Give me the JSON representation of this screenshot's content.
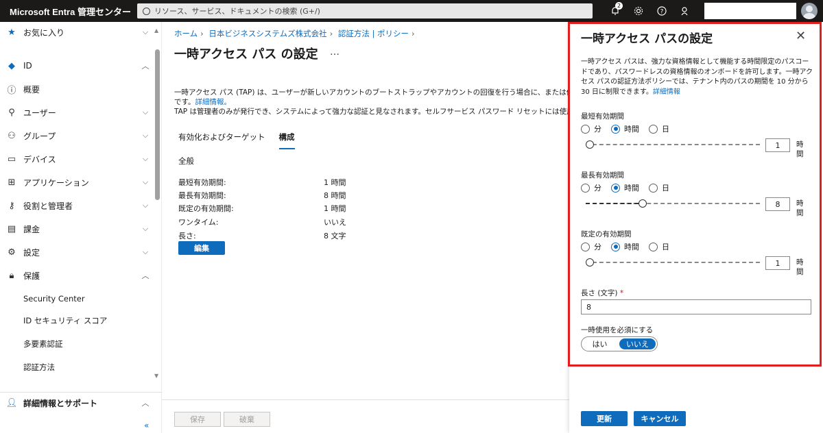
{
  "topbar": {
    "brand": "Microsoft Entra 管理センター",
    "search_placeholder": "リソース、サービス、ドキュメントの検索 (G+/)",
    "notification_count": "2"
  },
  "sidebar": {
    "favorites": "お気に入り",
    "id": "ID",
    "overview": "概要",
    "users": "ユーザー",
    "groups": "グループ",
    "devices": "デバイス",
    "applications": "アプリケーション",
    "roles": "役割と管理者",
    "billing": "課金",
    "settings": "設定",
    "protection": "保護",
    "sub_security_center": "Security Center",
    "sub_id_secure_score": "ID セキュリティ スコア",
    "sub_mfa": "多要素認証",
    "sub_auth_methods": "認証方法",
    "learn_support": "詳細情報とサポート",
    "collapse": "«"
  },
  "main": {
    "breadcrumb": [
      "ホーム",
      "日本ビジネスシステムズ株式会社",
      "認証方法 | ポリシー"
    ],
    "title": "一時アクセス パス の設定",
    "more": "…",
    "desc_line1": "一時アクセス パス (TAP) は、ユーザーが新しいアカウントのブートストラップやアカウントの回復を行う場合に、または他の認証方法を使",
    "desc_line2_prefix": "です。",
    "desc_link": "詳細情報。",
    "desc_line3": "TAP は管理者のみが発行でき、システムによって強力な認証と見なされます。セルフサービス パスワード リセットには使用できません。",
    "tabs": [
      "有効化およびターゲット",
      "構成"
    ],
    "section": "全般",
    "settings": [
      {
        "label": "最短有効期間:",
        "value": "1 時間"
      },
      {
        "label": "最長有効期間:",
        "value": "8 時間"
      },
      {
        "label": "既定の有効期間:",
        "value": "1 時間"
      },
      {
        "label": "ワンタイム:",
        "value": "いいえ"
      },
      {
        "label": "長さ:",
        "value": "8 文字"
      }
    ],
    "edit": "編集",
    "save": "保存",
    "discard": "破棄"
  },
  "panel": {
    "title": "一時アクセス パスの設定",
    "close": "✕",
    "desc": "一時アクセス パスは、強力な資格情報として機能する時間限定のパスコードであり、パスワードレスの資格情報のオンボードを許可します。一時アクセス パスの認証方法ポリシーでは、テナント内のパスの期間を 10 分から 30 日に制限できます。",
    "desc_link": "詳細情報",
    "unit_options": [
      "分",
      "時間",
      "日"
    ],
    "min_label": "最短有効期間",
    "min_value": "1",
    "min_fraction": 0.0,
    "max_label": "最長有効期間",
    "max_value": "8",
    "max_fraction": 0.32,
    "default_label": "既定の有効期間",
    "default_value": "1",
    "default_fraction": 0.0,
    "unit": "時間",
    "length_label": "長さ (文字)",
    "length_required": "*",
    "length_value": "8",
    "onetime_label": "一時使用を必須にする",
    "onetime_yes": "はい",
    "onetime_no": "いいえ",
    "update": "更新",
    "cancel": "キャンセル"
  },
  "colors": {
    "accent": "#0f6cbd",
    "highlight_border": "#e01e1e",
    "topbar": "#1b1a19"
  }
}
